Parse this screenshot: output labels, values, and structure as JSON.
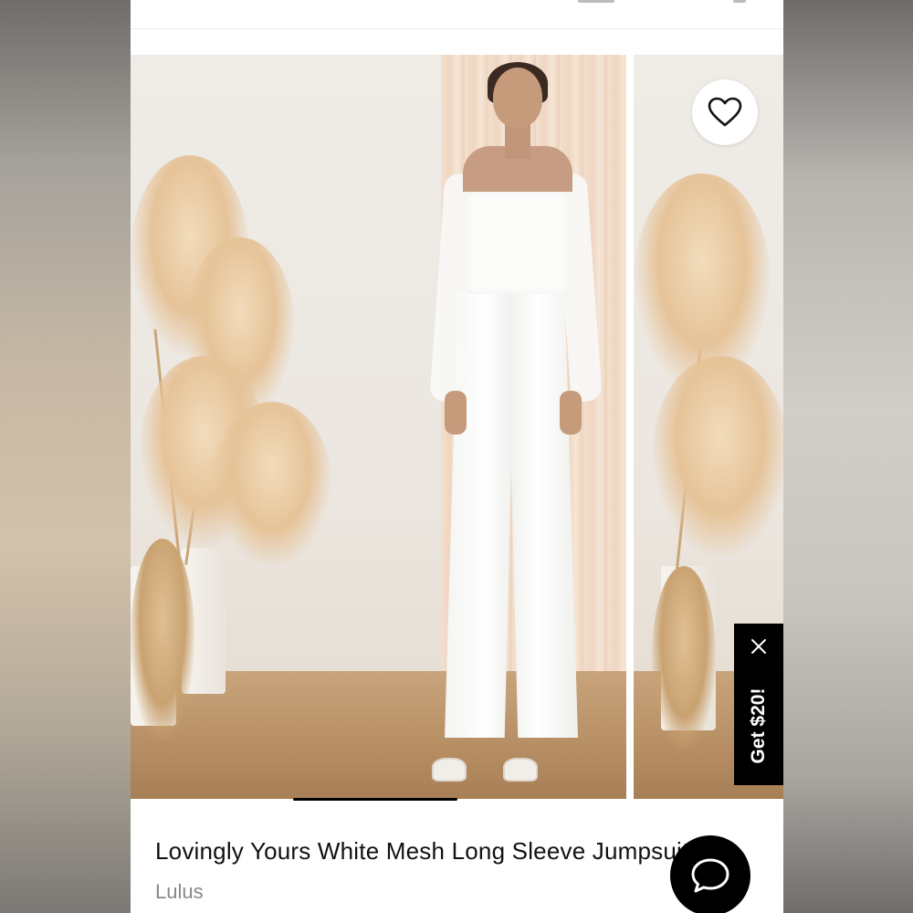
{
  "product": {
    "title": "Lovingly Yours White Mesh Long Sleeve Jumpsuit",
    "brand": "Lulus"
  },
  "promo": {
    "label": "Get $20!"
  },
  "icons": {
    "favorite": "heart-outline-icon",
    "close": "close-icon",
    "chat": "chat-bubble-icon"
  },
  "colors": {
    "background_page": "#ffffff",
    "promo_bg": "#000000",
    "chat_bg": "#000000",
    "title_text": "#111111",
    "brand_text": "#888888"
  }
}
